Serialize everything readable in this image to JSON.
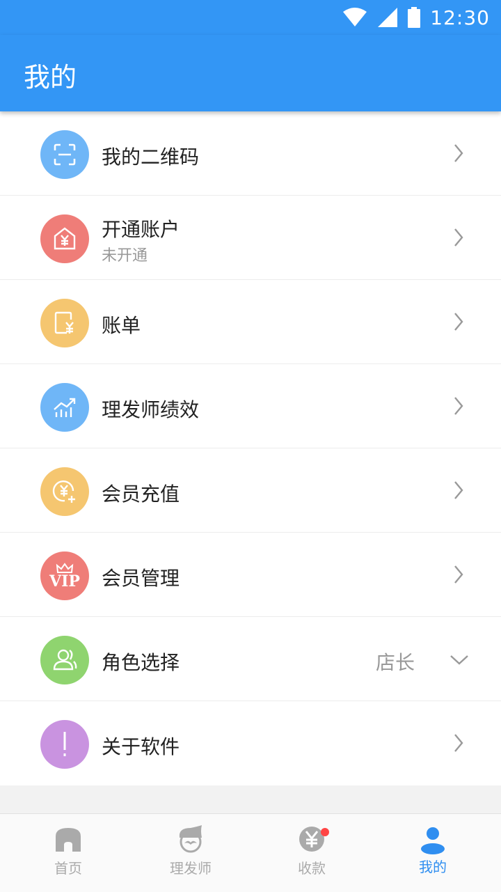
{
  "status": {
    "time": "12:30"
  },
  "header": {
    "title": "我的"
  },
  "menu": {
    "items": [
      {
        "label": "我的二维码",
        "icon": "qrcode-scan-icon",
        "color": "#6fb6f7"
      },
      {
        "label": "开通账户",
        "sub": "未开通",
        "icon": "account-house-icon",
        "color": "#ef7d78"
      },
      {
        "label": "账单",
        "icon": "bill-icon",
        "color": "#f5c670"
      },
      {
        "label": "理发师绩效",
        "icon": "performance-chart-icon",
        "color": "#6fb6f7"
      },
      {
        "label": "会员充值",
        "icon": "recharge-icon",
        "color": "#f5c670"
      },
      {
        "label": "会员管理",
        "icon": "vip-crown-icon",
        "color": "#ef7d78",
        "icon_text": "VIP"
      },
      {
        "label": "角色选择",
        "value": "店长",
        "icon": "users-icon",
        "color": "#8fd46f"
      },
      {
        "label": "关于软件",
        "icon": "exclamation-icon",
        "color": "#c993e0"
      }
    ]
  },
  "tabbar": {
    "tabs": [
      {
        "label": "首页",
        "icon": "home-icon"
      },
      {
        "label": "理发师",
        "icon": "barber-icon"
      },
      {
        "label": "收款",
        "icon": "payment-icon",
        "badge": true
      },
      {
        "label": "我的",
        "icon": "person-icon",
        "active": true
      }
    ],
    "active_color": "#2f8ef0",
    "inactive_color": "#aaaaaa"
  }
}
